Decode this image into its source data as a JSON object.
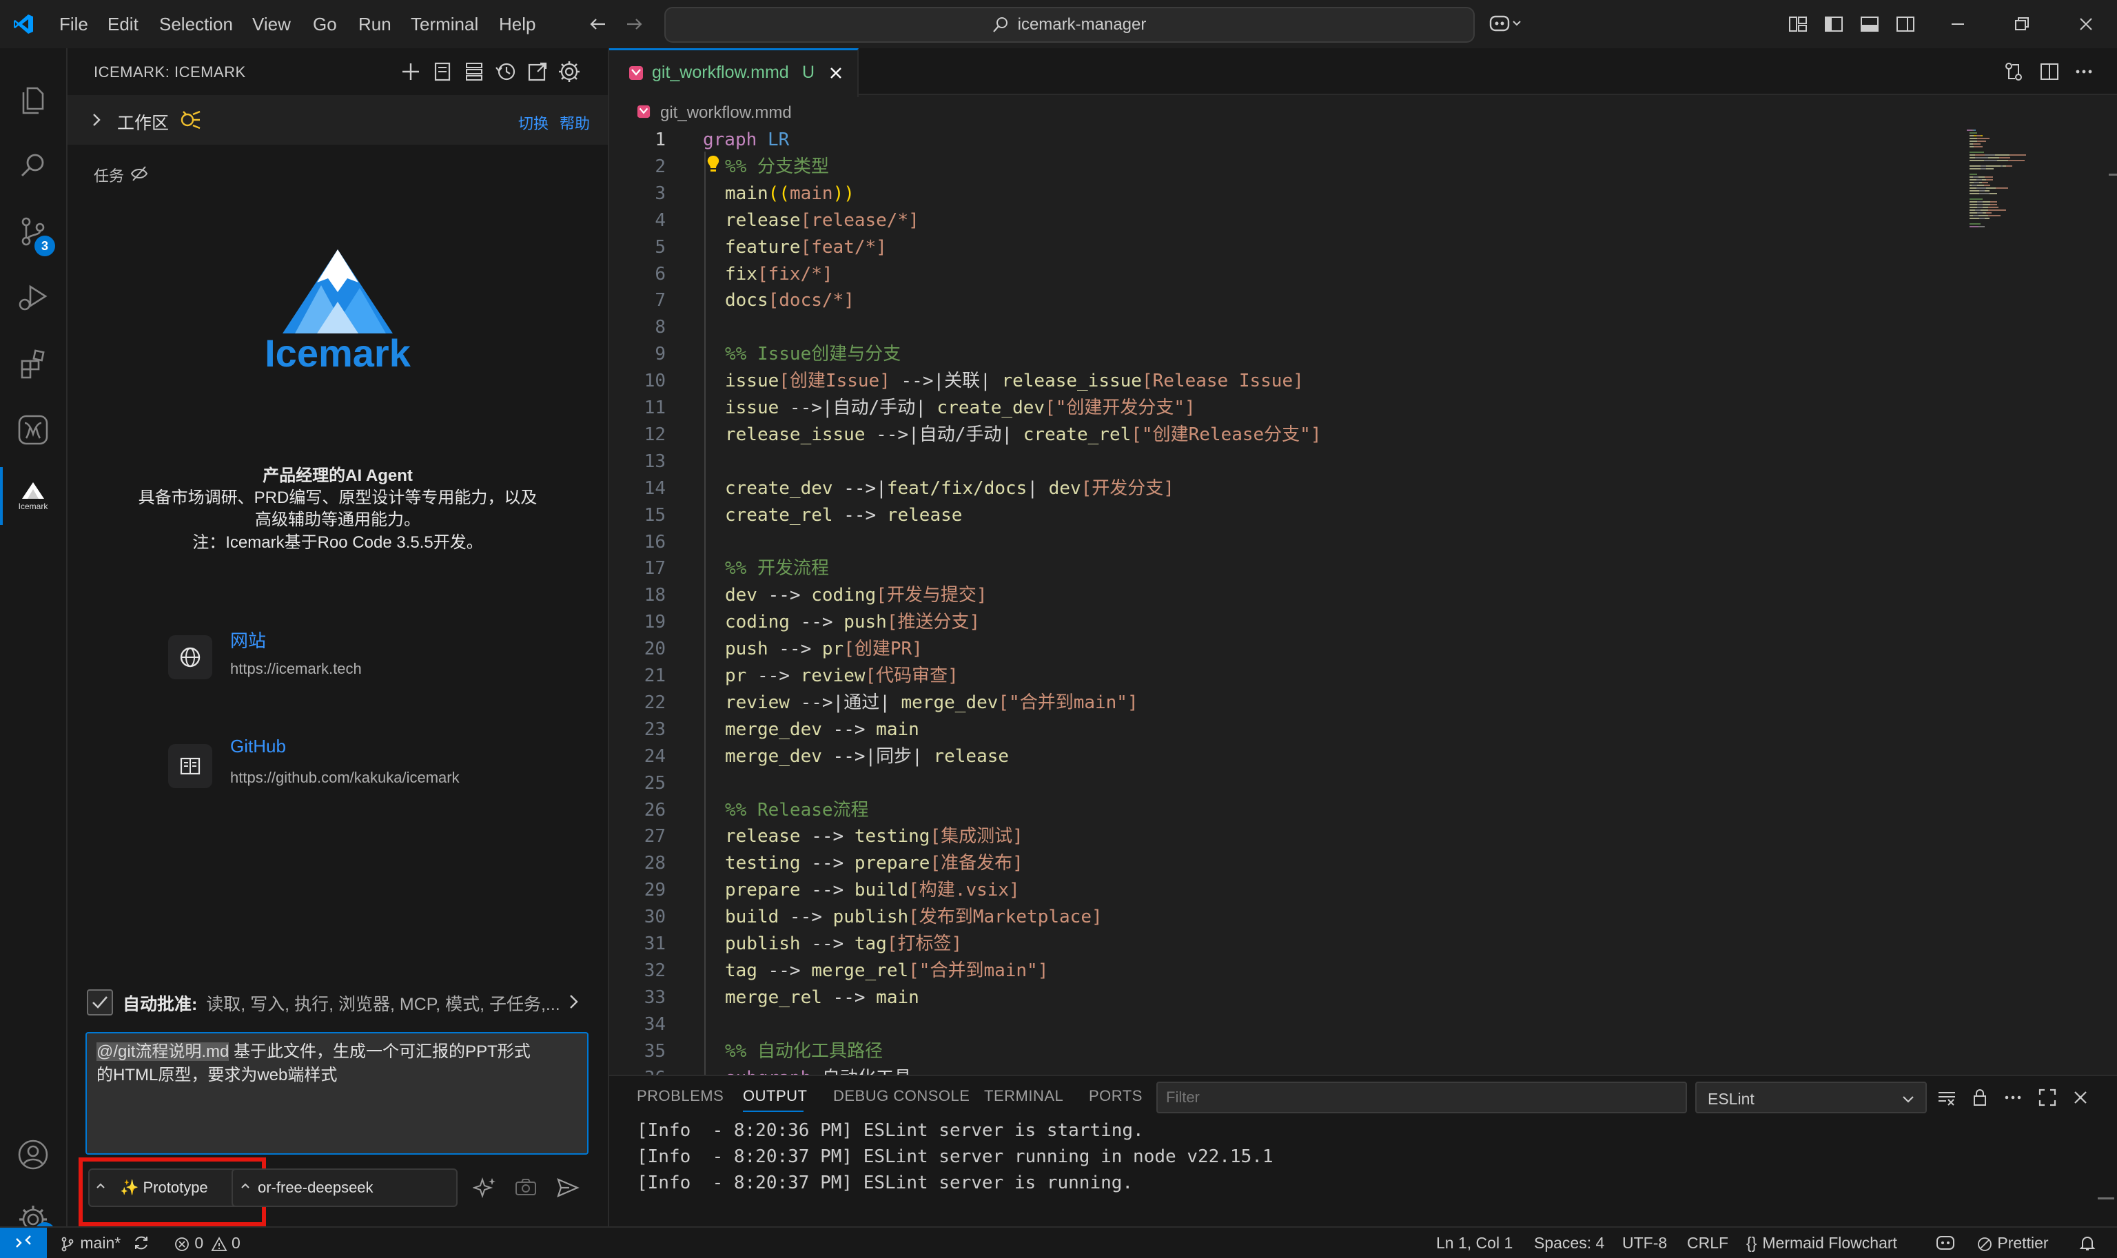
{
  "titlebar": {
    "menu": [
      "File",
      "Edit",
      "Selection",
      "View",
      "Go",
      "Run",
      "Terminal",
      "Help"
    ],
    "search_text": "icemark-manager"
  },
  "activity": {
    "scm_badge": "3",
    "settings_badge": "1",
    "icemark_label": "Icemark"
  },
  "sidebar": {
    "title": "ICEMARK: ICEMARK",
    "workspace_label": "工作区",
    "switch_label": "切换",
    "help_label": "帮助",
    "tasks_label": "任务",
    "logo_text": "Icemark",
    "agent_title": "产品经理的AI Agent",
    "agent_desc_1": "具备市场调研、PRD编写、原型设计等专用能力，以及",
    "agent_desc_2": "高级辅助等通用能力。",
    "agent_note": "注：Icemark基于Roo Code 3.5.5开发。",
    "website_label": "网站",
    "website_url": "https://icemark.tech",
    "github_label": "GitHub",
    "github_url": "https://github.com/kakuka/icemark",
    "auto_approve_label": "自动批准:",
    "auto_approve_items": "读取, 写入, 执行, 浏览器, MCP, 模式, 子任务,...",
    "input_mention": "@/git流程说明.md",
    "input_text_1": " 基于此文件，生成一个可汇报的PPT形式",
    "input_text_2": "的HTML原型，要求为web端样式",
    "mode_label": "✨ Prototype",
    "model_label": "or-free-deepseek"
  },
  "editor": {
    "tab_label": "git_workflow.mmd",
    "tab_status": "U",
    "breadcrumb": "git_workflow.mmd",
    "lines": [
      [
        [
          "c-kw",
          "graph"
        ],
        [
          "c-op",
          " "
        ],
        [
          "c-kw2",
          "LR"
        ]
      ],
      [
        [
          "c-cm",
          "%% 分支类型"
        ]
      ],
      [
        [
          "c-id",
          "main"
        ],
        [
          "c-br",
          "(("
        ],
        [
          "c-str",
          "main"
        ],
        [
          "c-br",
          "))"
        ]
      ],
      [
        [
          "c-id",
          "release"
        ],
        [
          "c-str",
          "[release/*]"
        ]
      ],
      [
        [
          "c-id",
          "feature"
        ],
        [
          "c-str",
          "[feat/*]"
        ]
      ],
      [
        [
          "c-id",
          "fix"
        ],
        [
          "c-str",
          "[fix/*]"
        ]
      ],
      [
        [
          "c-id",
          "docs"
        ],
        [
          "c-str",
          "[docs/*]"
        ]
      ],
      [],
      [
        [
          "c-cm",
          "%% Issue创建与分支"
        ]
      ],
      [
        [
          "c-id",
          "issue"
        ],
        [
          "c-str",
          "[创建Issue]"
        ],
        [
          "c-op",
          " -->"
        ],
        [
          "c-op",
          "|关联| "
        ],
        [
          "c-id",
          "release_issue"
        ],
        [
          "c-str",
          "[Release Issue]"
        ]
      ],
      [
        [
          "c-id",
          "issue"
        ],
        [
          "c-op",
          " -->|自动/手动| "
        ],
        [
          "c-id",
          "create_dev"
        ],
        [
          "c-str",
          "[\"创建开发分支\"]"
        ]
      ],
      [
        [
          "c-id",
          "release_issue"
        ],
        [
          "c-op",
          " -->|自动/手动| "
        ],
        [
          "c-id",
          "create_rel"
        ],
        [
          "c-str",
          "[\"创建Release分支\"]"
        ]
      ],
      [],
      [
        [
          "c-id",
          "create_dev"
        ],
        [
          "c-op",
          " -->|"
        ],
        [
          "c-id",
          "feat/fix/docs"
        ],
        [
          "c-op",
          "| "
        ],
        [
          "c-id",
          "dev"
        ],
        [
          "c-str",
          "[开发分支]"
        ]
      ],
      [
        [
          "c-id",
          "create_rel"
        ],
        [
          "c-op",
          " --> "
        ],
        [
          "c-id",
          "release"
        ]
      ],
      [],
      [
        [
          "c-cm",
          "%% 开发流程"
        ]
      ],
      [
        [
          "c-id",
          "dev"
        ],
        [
          "c-op",
          " --> "
        ],
        [
          "c-id",
          "coding"
        ],
        [
          "c-str",
          "[开发与提交]"
        ]
      ],
      [
        [
          "c-id",
          "coding"
        ],
        [
          "c-op",
          " --> "
        ],
        [
          "c-id",
          "push"
        ],
        [
          "c-str",
          "[推送分支]"
        ]
      ],
      [
        [
          "c-id",
          "push"
        ],
        [
          "c-op",
          " --> "
        ],
        [
          "c-id",
          "pr"
        ],
        [
          "c-str",
          "[创建PR]"
        ]
      ],
      [
        [
          "c-id",
          "pr"
        ],
        [
          "c-op",
          " --> "
        ],
        [
          "c-id",
          "review"
        ],
        [
          "c-str",
          "[代码审查]"
        ]
      ],
      [
        [
          "c-id",
          "review"
        ],
        [
          "c-op",
          " -->|通过| "
        ],
        [
          "c-id",
          "merge_dev"
        ],
        [
          "c-str",
          "[\"合并到main\"]"
        ]
      ],
      [
        [
          "c-id",
          "merge_dev"
        ],
        [
          "c-op",
          " --> "
        ],
        [
          "c-id",
          "main"
        ]
      ],
      [
        [
          "c-id",
          "merge_dev"
        ],
        [
          "c-op",
          " -->|同步| "
        ],
        [
          "c-id",
          "release"
        ]
      ],
      [],
      [
        [
          "c-cm",
          "%% Release流程"
        ]
      ],
      [
        [
          "c-id",
          "release"
        ],
        [
          "c-op",
          " --> "
        ],
        [
          "c-id",
          "testing"
        ],
        [
          "c-str",
          "[集成测试]"
        ]
      ],
      [
        [
          "c-id",
          "testing"
        ],
        [
          "c-op",
          " --> "
        ],
        [
          "c-id",
          "prepare"
        ],
        [
          "c-str",
          "[准备发布]"
        ]
      ],
      [
        [
          "c-id",
          "prepare"
        ],
        [
          "c-op",
          " --> "
        ],
        [
          "c-id",
          "build"
        ],
        [
          "c-str",
          "[构建.vsix]"
        ]
      ],
      [
        [
          "c-id",
          "build"
        ],
        [
          "c-op",
          " --> "
        ],
        [
          "c-id",
          "publish"
        ],
        [
          "c-str",
          "[发布到Marketplace]"
        ]
      ],
      [
        [
          "c-id",
          "publish"
        ],
        [
          "c-op",
          " --> "
        ],
        [
          "c-id",
          "tag"
        ],
        [
          "c-str",
          "[打标签]"
        ]
      ],
      [
        [
          "c-id",
          "tag"
        ],
        [
          "c-op",
          " --> "
        ],
        [
          "c-id",
          "merge_rel"
        ],
        [
          "c-str",
          "[\"合并到main\"]"
        ]
      ],
      [
        [
          "c-id",
          "merge_rel"
        ],
        [
          "c-op",
          " --> "
        ],
        [
          "c-id",
          "main"
        ]
      ],
      [],
      [
        [
          "c-cm",
          "%% 自动化工具路径"
        ]
      ],
      [
        [
          "c-kw",
          "subgraph"
        ],
        [
          "c-op",
          " 自动化工具"
        ]
      ]
    ]
  },
  "panel": {
    "tabs": [
      "PROBLEMS",
      "OUTPUT",
      "DEBUG CONSOLE",
      "TERMINAL",
      "PORTS"
    ],
    "active_tab": "OUTPUT",
    "filter_placeholder": "Filter",
    "channel": "ESLint",
    "output": [
      "[Info  - 8:20:36 PM] ESLint server is starting.",
      "[Info  - 8:20:37 PM] ESLint server running in node v22.15.1",
      "[Info  - 8:20:37 PM] ESLint server is running."
    ]
  },
  "statusbar": {
    "branch": "main*",
    "errors": "0",
    "warnings": "0",
    "position": "Ln 1, Col 1",
    "spaces": "Spaces: 4",
    "encoding": "UTF-8",
    "eol": "CRLF",
    "language": "Mermaid Flowchart",
    "prettier": "Prettier"
  },
  "colors": {
    "accent": "#0078d4",
    "link": "#3794ff",
    "highlight_box": "#e5170f",
    "logo_blue": "#1e88e5"
  }
}
